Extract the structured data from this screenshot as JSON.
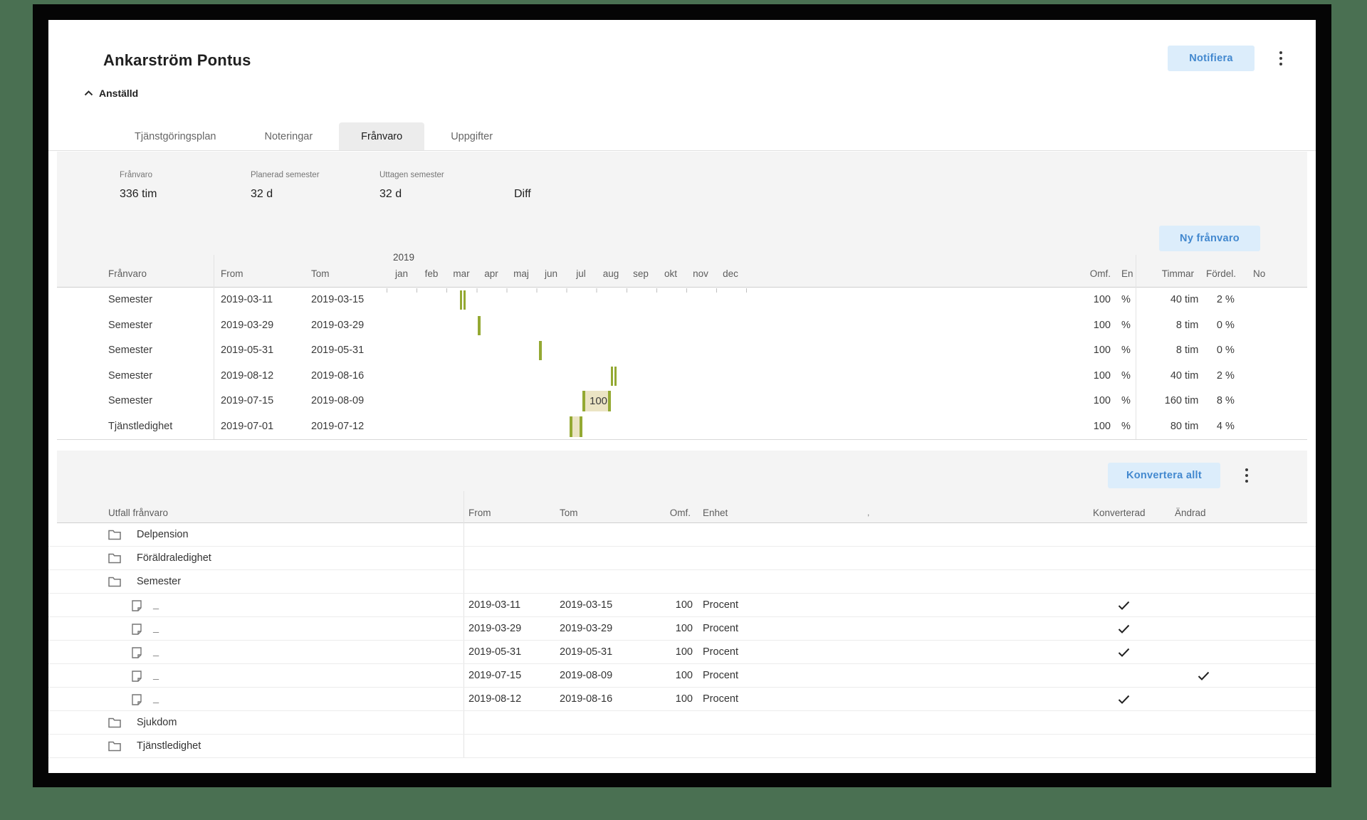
{
  "header": {
    "title": "Ankarström Pontus",
    "notify_label": "Notifiera",
    "collapse_label": "Anställd"
  },
  "tabs": [
    {
      "label": "Tjänstgöringsplan",
      "active": false
    },
    {
      "label": "Noteringar",
      "active": false
    },
    {
      "label": "Frånvaro",
      "active": true
    },
    {
      "label": "Uppgifter",
      "active": false
    }
  ],
  "summary": {
    "items": [
      {
        "label": "Frånvaro",
        "value": "336 tim"
      },
      {
        "label": "Planerad semester",
        "value": "32 d"
      },
      {
        "label": "Uttagen semester",
        "value": "32 d"
      }
    ],
    "diff_label": "Diff"
  },
  "absence": {
    "new_button": "Ny frånvaro",
    "year": "2019",
    "months": [
      "jan",
      "feb",
      "mar",
      "apr",
      "maj",
      "jun",
      "jul",
      "aug",
      "sep",
      "okt",
      "nov",
      "dec"
    ],
    "columns": {
      "type": "Frånvaro",
      "from": "From",
      "tom": "Tom",
      "omf": "Omf.",
      "en": "En",
      "timmar": "Timmar",
      "fordel": "Fördel.",
      "no": "No"
    },
    "rows": [
      {
        "type": "Semester",
        "from": "2019-03-11",
        "tom": "2019-03-15",
        "omf": "100",
        "omf_unit": "%",
        "timmar": "40",
        "timmar_unit": "tim",
        "fordel": "2",
        "fordel_unit": "%"
      },
      {
        "type": "Semester",
        "from": "2019-03-29",
        "tom": "2019-03-29",
        "omf": "100",
        "omf_unit": "%",
        "timmar": "8",
        "timmar_unit": "tim",
        "fordel": "0",
        "fordel_unit": "%"
      },
      {
        "type": "Semester",
        "from": "2019-05-31",
        "tom": "2019-05-31",
        "omf": "100",
        "omf_unit": "%",
        "timmar": "8",
        "timmar_unit": "tim",
        "fordel": "0",
        "fordel_unit": "%"
      },
      {
        "type": "Semester",
        "from": "2019-08-12",
        "tom": "2019-08-16",
        "omf": "100",
        "omf_unit": "%",
        "timmar": "40",
        "timmar_unit": "tim",
        "fordel": "2",
        "fordel_unit": "%"
      },
      {
        "type": "Semester",
        "from": "2019-07-15",
        "tom": "2019-08-09",
        "omf": "100",
        "omf_unit": "%",
        "timmar": "160",
        "timmar_unit": "tim",
        "fordel": "8",
        "fordel_unit": "%",
        "bar_label": "100"
      },
      {
        "type": "Tjänstledighet",
        "from": "2019-07-01",
        "tom": "2019-07-12",
        "omf": "100",
        "omf_unit": "%",
        "timmar": "80",
        "timmar_unit": "tim",
        "fordel": "4",
        "fordel_unit": "%"
      }
    ]
  },
  "outcome": {
    "convert_button": "Konvertera allt",
    "columns": {
      "name": "Utfall frånvaro",
      "from": "From",
      "tom": "Tom",
      "omf": "Omf.",
      "enhet": "Enhet",
      "note": ",",
      "konverterad": "Konverterad",
      "andrad": "Ändrad"
    },
    "rows": [
      {
        "kind": "folder",
        "label": "Delpension"
      },
      {
        "kind": "folder",
        "label": "Föräldraledighet"
      },
      {
        "kind": "folder",
        "label": "Semester"
      },
      {
        "kind": "item",
        "label": "_",
        "from": "2019-03-11",
        "tom": "2019-03-15",
        "omf": "100",
        "enhet": "Procent",
        "konverterad": true,
        "andrad": false
      },
      {
        "kind": "item",
        "label": "_",
        "from": "2019-03-29",
        "tom": "2019-03-29",
        "omf": "100",
        "enhet": "Procent",
        "konverterad": true,
        "andrad": false
      },
      {
        "kind": "item",
        "label": "_",
        "from": "2019-05-31",
        "tom": "2019-05-31",
        "omf": "100",
        "enhet": "Procent",
        "konverterad": true,
        "andrad": false
      },
      {
        "kind": "item",
        "label": "_",
        "from": "2019-07-15",
        "tom": "2019-08-09",
        "omf": "100",
        "enhet": "Procent",
        "konverterad": false,
        "andrad": true
      },
      {
        "kind": "item",
        "label": "_",
        "from": "2019-08-12",
        "tom": "2019-08-16",
        "omf": "100",
        "enhet": "Procent",
        "konverterad": true,
        "andrad": false
      },
      {
        "kind": "folder",
        "label": "Sjukdom"
      },
      {
        "kind": "folder",
        "label": "Tjänstledighet"
      }
    ]
  }
}
